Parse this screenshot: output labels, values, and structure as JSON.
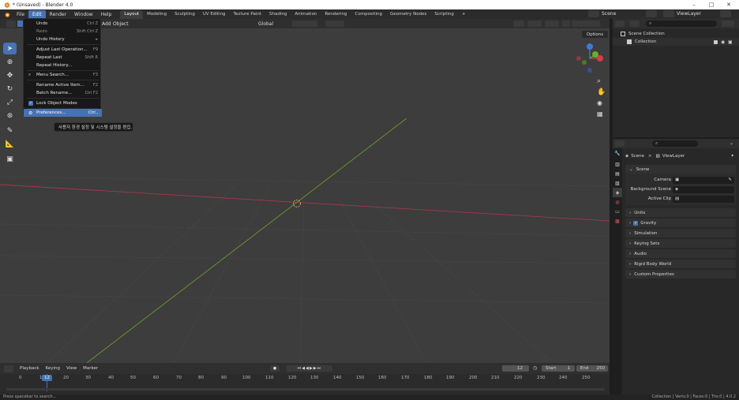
{
  "window": {
    "title": "* (Unsaved) - Blender 4.0",
    "minimize": "–",
    "maximize": "□",
    "close": "✕"
  },
  "menubar": {
    "items": [
      "File",
      "Edit",
      "Render",
      "Window",
      "Help"
    ]
  },
  "workspaces": [
    "Layout",
    "Modeling",
    "Sculpting",
    "UV Editing",
    "Texture Paint",
    "Shading",
    "Animation",
    "Rendering",
    "Compositing",
    "Geometry Nodes",
    "Scripting"
  ],
  "workspace_add": "+",
  "scene": {
    "name": "Scene",
    "view_layer": "ViewLayer"
  },
  "viewport": {
    "header_items": [
      "Add",
      "Object"
    ],
    "transform": "Global",
    "options": "Options"
  },
  "edit_menu": {
    "items": [
      {
        "label": "Undo",
        "shortcut": "Ctrl Z",
        "dim": false
      },
      {
        "label": "Redo",
        "shortcut": "Shift Ctrl Z",
        "dim": true
      },
      {
        "label": "Undo History",
        "shortcut": "▸",
        "dim": false
      },
      {
        "label": "Adjust Last Operation...",
        "shortcut": "F9",
        "dim": false
      },
      {
        "label": "Repeat Last",
        "shortcut": "Shift R",
        "dim": false
      },
      {
        "label": "Repeat History...",
        "shortcut": "",
        "dim": false
      },
      {
        "label": "Menu Search...",
        "shortcut": "F3",
        "dim": false
      },
      {
        "label": "Rename Active Item...",
        "shortcut": "F2",
        "dim": false
      },
      {
        "label": "Batch Rename...",
        "shortcut": "Ctrl F2",
        "dim": false
      },
      {
        "label": "Lock Object Modes",
        "shortcut": "",
        "dim": false
      },
      {
        "label": "Preferences...",
        "shortcut": "Ctrl ,",
        "dim": false
      }
    ],
    "tooltip": "사용자 환경 설정 및 시스템 설정을 편집."
  },
  "outliner": {
    "scene_collection": "Scene Collection",
    "collection": "Collection"
  },
  "properties": {
    "breadcrumb_scene": "Scene",
    "breadcrumb_sep": ">",
    "breadcrumb_layer": "ViewLayer",
    "scene_panel": "Scene",
    "camera_label": "Camera",
    "background_label": "Background Scene",
    "clip_label": "Active Clip",
    "panels": [
      "Units",
      "Gravity",
      "Simulation",
      "Keying Sets",
      "Audio",
      "Rigid Body World",
      "Custom Properties"
    ]
  },
  "timeline": {
    "menus": [
      "Playback",
      "Keying",
      "View",
      "Marker"
    ],
    "current_frame": "12",
    "start_label": "Start",
    "start": "1",
    "end_label": "End",
    "end": "250",
    "ruler": [
      "0",
      "10",
      "20",
      "30",
      "40",
      "50",
      "60",
      "70",
      "80",
      "90",
      "100",
      "110",
      "120",
      "130",
      "140",
      "150",
      "160",
      "170",
      "180",
      "190",
      "200",
      "210",
      "220",
      "230",
      "240",
      "250"
    ],
    "playhead": "12"
  },
  "status": {
    "hint": "Press spacebar to search...",
    "stats": "Collection | Verts:0 | Faces:0 | Tris:0 | 4.0.2"
  },
  "colors": {
    "accent": "#4772b3",
    "x_axis": "#a03a47",
    "y_axis": "#6a9a2a",
    "gizmo_x": "#d63c4c",
    "gizmo_y": "#6bad2a",
    "gizmo_z": "#3c7bd6"
  }
}
